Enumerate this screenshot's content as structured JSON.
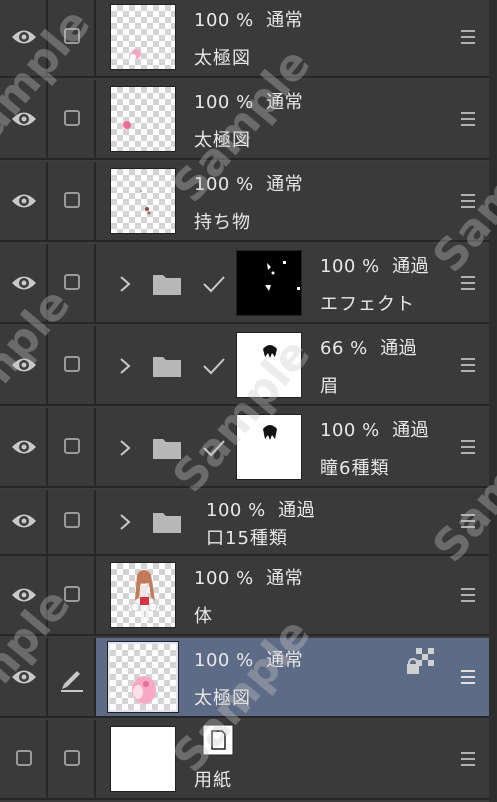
{
  "layers": [
    {
      "opacity": "100 %",
      "blend": "通常",
      "name": "太極図",
      "selected": false,
      "type": "raster",
      "thumb": "pink-small-1"
    },
    {
      "opacity": "100 %",
      "blend": "通常",
      "name": "太極図",
      "selected": false,
      "type": "raster",
      "thumb": "pink-small-2"
    },
    {
      "opacity": "100 %",
      "blend": "通常",
      "name": "持ち物",
      "selected": false,
      "type": "raster",
      "thumb": "dots"
    },
    {
      "opacity": "100 %",
      "blend": "通過",
      "name": "エフェクト",
      "selected": false,
      "type": "folder",
      "thumb": "black-mask"
    },
    {
      "opacity": "66 %",
      "blend": "通過",
      "name": "眉",
      "selected": false,
      "type": "folder",
      "thumb": "white-mask"
    },
    {
      "opacity": "100 %",
      "blend": "通過",
      "name": "瞳6種類",
      "selected": false,
      "type": "folder",
      "thumb": "white-mask"
    },
    {
      "opacity": "100 %",
      "blend": "通過",
      "name": "口15種類",
      "selected": false,
      "type": "folder-nothumb"
    },
    {
      "opacity": "100 %",
      "blend": "通常",
      "name": "体",
      "selected": false,
      "type": "raster",
      "thumb": "character"
    },
    {
      "opacity": "100 %",
      "blend": "通常",
      "name": "太極図",
      "selected": true,
      "type": "raster",
      "thumb": "pink-large"
    },
    {
      "opacity": "",
      "blend": "",
      "name": "用紙",
      "selected": false,
      "type": "paper",
      "thumb": "white"
    }
  ],
  "watermark": "Sample",
  "colors": {
    "panel": "#3c3c3c",
    "selected": "#5e6b86",
    "divider": "#262626",
    "icon": "#b0b0b0"
  },
  "icons": [
    "eye-icon",
    "checkbox-icon",
    "chevron-right-icon",
    "folder-icon",
    "check-icon",
    "menu-icon",
    "pen-icon",
    "lock-transparency-icon",
    "paper-icon"
  ]
}
